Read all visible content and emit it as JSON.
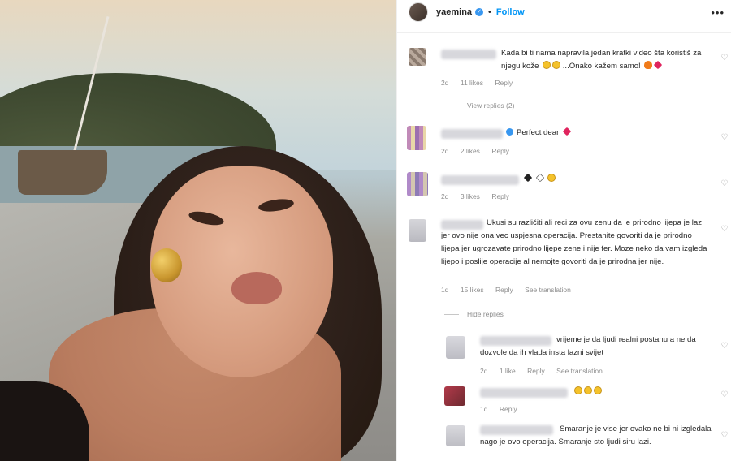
{
  "post": {
    "username": "yaemina",
    "follow_label": "Follow",
    "separator": "•",
    "more_label": "•••"
  },
  "comments": [
    {
      "text": "Kada bi ti nama napravila jedan kratki video šta koristiš za njegu kože",
      "text_tail": "...Onako kažem samo!",
      "time": "2d",
      "likes": "11 likes",
      "reply": "Reply",
      "view_replies": "View replies (2)"
    },
    {
      "text": "Perfect dear",
      "time": "2d",
      "likes": "2 likes",
      "reply": "Reply"
    },
    {
      "text": "",
      "time": "2d",
      "likes": "3 likes",
      "reply": "Reply"
    },
    {
      "text": "Ukusi su različiti ali reci za ovu zenu da je prirodno lijepa je laz jer ovo nije ona vec uspjesna operacija. Prestanite govoriti da je prirodno lijepa jer ugrozavate prirodno lijepe zene i nije fer. Moze neko da vam izgleda lijepo i poslije operacije al nemojte govoriti da je prirodna jer nije.",
      "time": "1d",
      "likes": "15 likes",
      "reply": "Reply",
      "translate": "See translation",
      "hide_replies": "Hide replies"
    }
  ],
  "replies": [
    {
      "text": "vrijeme je da ljudi realni postanu a ne da dozvole da ih vlada insta lazni svijet",
      "time": "2d",
      "likes": "1 like",
      "reply": "Reply",
      "translate": "See translation"
    },
    {
      "text": "",
      "time": "1d",
      "reply": "Reply"
    },
    {
      "text": "Smaranje je vise jer ovako ne bi ni izgledala nago je ovo operacija. Smaranje sto ljudi siru lazi."
    }
  ],
  "icons": {
    "heart": "heart-outline-icon",
    "verified": "verified-badge-icon"
  },
  "colors": {
    "link_blue": "#0095f6",
    "verified_blue": "#3897f0",
    "meta_gray": "#8e8e8e"
  }
}
